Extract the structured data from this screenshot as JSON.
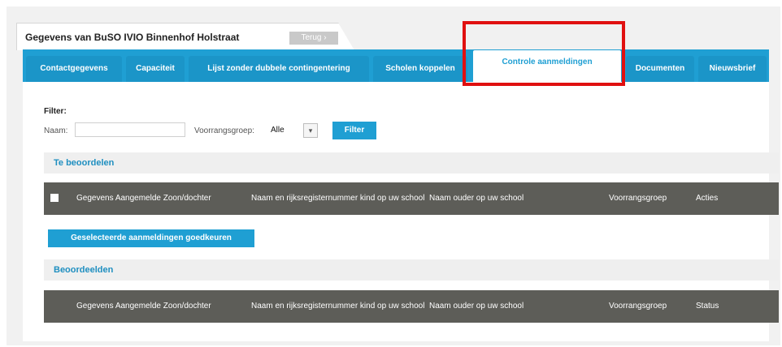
{
  "header": {
    "title": "Gegevens van BuSO IVIO Binnenhof Holstraat",
    "back_label": "Terug ›"
  },
  "tabs": [
    {
      "label": "Contactgegevens"
    },
    {
      "label": "Capaciteit"
    },
    {
      "label": "Lijst zonder dubbele contingentering"
    },
    {
      "label": "Scholen koppelen"
    },
    {
      "label": "Controle aanmeldingen",
      "active": true
    },
    {
      "label": "Documenten"
    },
    {
      "label": "Nieuwsbrief"
    }
  ],
  "filter": {
    "title": "Filter:",
    "naam_label": "Naam:",
    "naam_value": "",
    "voorrangsgroep_label": "Voorrangsgroep:",
    "voorrangsgroep_value": "Alle",
    "button_label": "Filter"
  },
  "te_beoordelen": {
    "title": "Te beoordelen",
    "columns": [
      "Gegevens Aangemelde Zoon/dochter",
      "Naam en rijksregisternummer kind op uw school",
      "Naam ouder op uw school",
      "Voorrangsgroep",
      "Acties"
    ],
    "approve_label": "Geselecteerde aanmeldingen goedkeuren"
  },
  "beoordeelden": {
    "title": "Beoordeelden",
    "columns": [
      "Gegevens Aangemelde Zoon/dochter",
      "Naam en rijksregisternummer kind op uw school",
      "Naam ouder op uw school",
      "Voorrangsgroep",
      "Status"
    ]
  },
  "colors": {
    "accent": "#1f9fd3",
    "table_header": "#5d5d58",
    "highlight": "#e01010"
  }
}
